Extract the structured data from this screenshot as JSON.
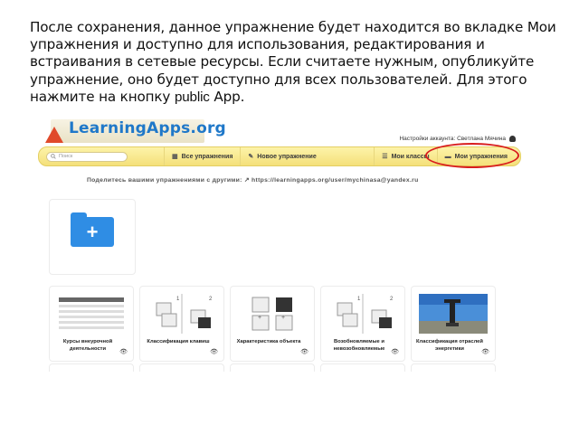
{
  "instruction": {
    "text": "После сохранения, данное упражнение будет находится во вкладке Мои упражнения и доступно для использования, редактирования и встраивания в сетевые ресурсы. Если считаете нужным, опубликуйте упражнение, оно будет доступно для всех пользователей. Для этого нажмите на кнопку ",
    "code": "public",
    "tail": " App."
  },
  "app": {
    "logo": "LearningApps.org",
    "account": "Настройки аккаунта: Светлана Мячина"
  },
  "navbar": {
    "search_placeholder": "Поиск",
    "items": [
      {
        "label": "Все упражнения",
        "icon": "grid-icon"
      },
      {
        "label": "Новое упражнение",
        "icon": "pencil-icon"
      },
      {
        "label": "Мои классы",
        "icon": "list-icon"
      },
      {
        "label": "Мои упражнения",
        "icon": "folder-icon"
      }
    ]
  },
  "share": "Поделитесь вашими упражнениями с другими: ↗ https://learningapps.org/user/mychinasa@yandex.ru",
  "cards": [
    {
      "title": "Курсы внеурочной деятельности"
    },
    {
      "title": "Классификация клавиш"
    },
    {
      "title": "Характеристика объекта"
    },
    {
      "title": "Возобновляемые и невозобновляемые"
    },
    {
      "title": "Классификация отраслей энергетики"
    }
  ],
  "colors": {
    "highlight": "#d81e1e",
    "navbar": "#fdf3a9",
    "folder": "#2f8de4"
  }
}
